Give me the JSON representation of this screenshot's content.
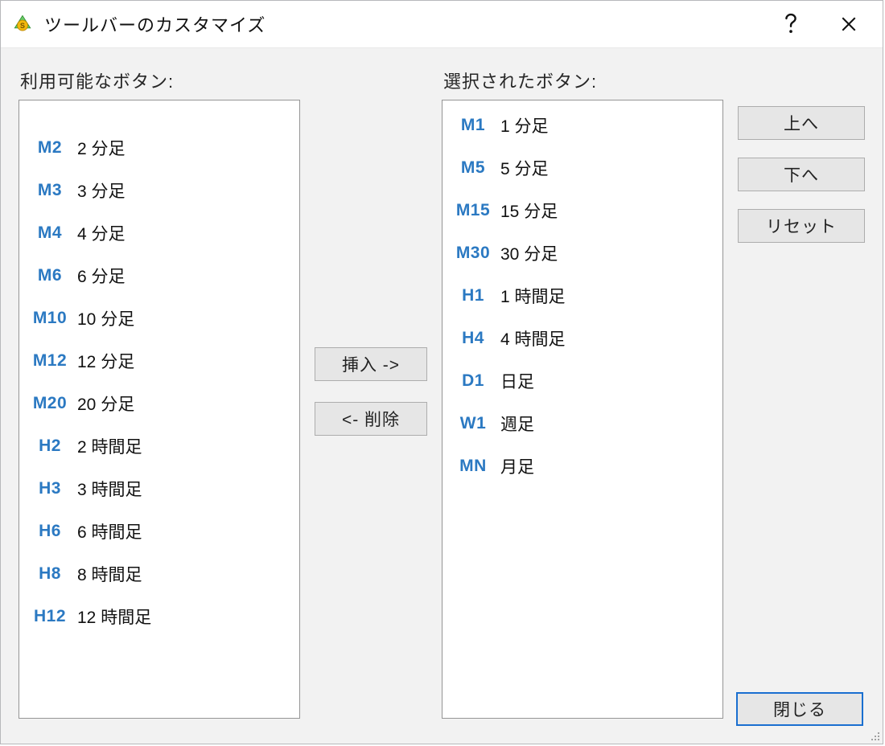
{
  "window": {
    "title": "ツールバーのカスタマイズ"
  },
  "labels": {
    "available": "利用可能なボタン:",
    "selected": "選択されたボタン:"
  },
  "buttons": {
    "insert": "挿入 ->",
    "remove": "<- 削除",
    "up": "上へ",
    "down": "下へ",
    "reset": "リセット",
    "close": "閉じる"
  },
  "available": [
    {
      "code": "M2",
      "desc": "2 分足"
    },
    {
      "code": "M3",
      "desc": "3 分足"
    },
    {
      "code": "M4",
      "desc": "4 分足"
    },
    {
      "code": "M6",
      "desc": "6 分足"
    },
    {
      "code": "M10",
      "desc": "10 分足"
    },
    {
      "code": "M12",
      "desc": "12 分足"
    },
    {
      "code": "M20",
      "desc": "20 分足"
    },
    {
      "code": "H2",
      "desc": "2 時間足"
    },
    {
      "code": "H3",
      "desc": "3 時間足"
    },
    {
      "code": "H6",
      "desc": "6 時間足"
    },
    {
      "code": "H8",
      "desc": "8 時間足"
    },
    {
      "code": "H12",
      "desc": "12 時間足"
    }
  ],
  "selected": [
    {
      "code": "M1",
      "desc": "1 分足"
    },
    {
      "code": "M5",
      "desc": "5 分足"
    },
    {
      "code": "M15",
      "desc": "15 分足"
    },
    {
      "code": "M30",
      "desc": "30 分足"
    },
    {
      "code": "H1",
      "desc": "1 時間足"
    },
    {
      "code": "H4",
      "desc": "4 時間足"
    },
    {
      "code": "D1",
      "desc": "日足"
    },
    {
      "code": "W1",
      "desc": "週足"
    },
    {
      "code": "MN",
      "desc": "月足"
    }
  ]
}
